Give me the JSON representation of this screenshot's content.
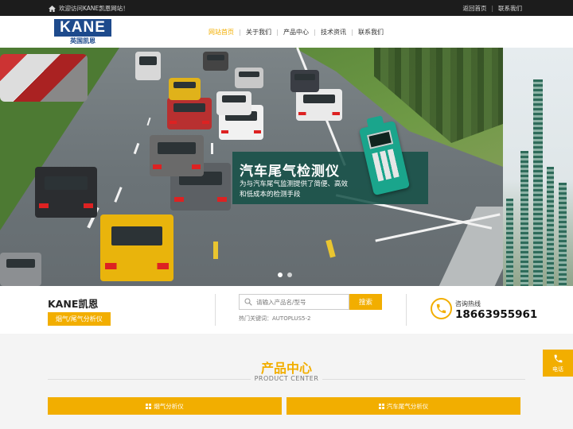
{
  "topbar": {
    "welcome": "欢迎访问KANE凯恩网站！",
    "links": [
      "返回首页",
      "联系我们"
    ]
  },
  "header": {
    "logo_word": "KANE",
    "logo_cn": "英国凯恩",
    "nav": [
      {
        "label": "网站首页",
        "active": true
      },
      {
        "label": "关于我们",
        "active": false
      },
      {
        "label": "产品中心",
        "active": false
      },
      {
        "label": "技术资讯",
        "active": false
      },
      {
        "label": "联系我们",
        "active": false
      }
    ]
  },
  "banner": {
    "title": "汽车尾气检测仪",
    "desc": "为与汽车尾气监测提供了简便、高效和低成本的检测手段",
    "slides": 2,
    "active_slide": 1
  },
  "info": {
    "brand": "KANE凯恩",
    "tag": "烟气/尾气分析仪",
    "search_placeholder": "请输入产品名/型号",
    "search_button": "搜索",
    "hotwords": "热门关键词：AUTOPLUS5-2",
    "hotline_label": "咨询热线",
    "hotline_number": "18663955961"
  },
  "products": {
    "title": "产品中心",
    "subtitle": "PRODUCT CENTER",
    "categories": [
      "烟气分析仪",
      "汽车尾气分析仪"
    ]
  },
  "float": {
    "label": "电话"
  },
  "colors": {
    "accent": "#f2ae00",
    "brand_blue": "#1d4a8c",
    "topbar": "#1c1c1c"
  },
  "icons": [
    "home-icon",
    "search-icon",
    "phone-icon",
    "grid-icon"
  ]
}
